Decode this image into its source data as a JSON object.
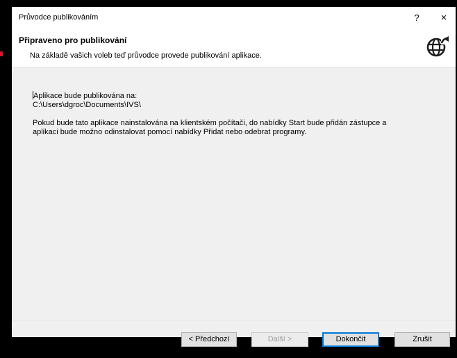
{
  "window": {
    "title": "Průvodce publikováním",
    "help_label": "?",
    "close_label": "×"
  },
  "header": {
    "title": "Připraveno pro publikování",
    "subtitle": "Na základě vašich voleb teď průvodce provede publikování aplikace.",
    "icon": "globe-publish-icon"
  },
  "body": {
    "line1": "Aplikace bude publikována na:",
    "path": "C:\\Users\\dgroc\\Documents\\IVS\\",
    "paragraph2_line1": "Pokud bude tato aplikace nainstalována na klientském počítači, do nabídky Start bude přidán zástupce a",
    "paragraph2_line2": "aplikaci bude možno odinstalovat pomocí nabídky Přidat nebo odebrat programy."
  },
  "buttons": {
    "previous": "< Předchozí",
    "next": "Další >",
    "finish": "Dokončit",
    "cancel": "Zrušit"
  },
  "colors": {
    "accent": "#0078d7",
    "dialog_bg": "#f0f0f0",
    "header_bg": "#ffffff"
  }
}
